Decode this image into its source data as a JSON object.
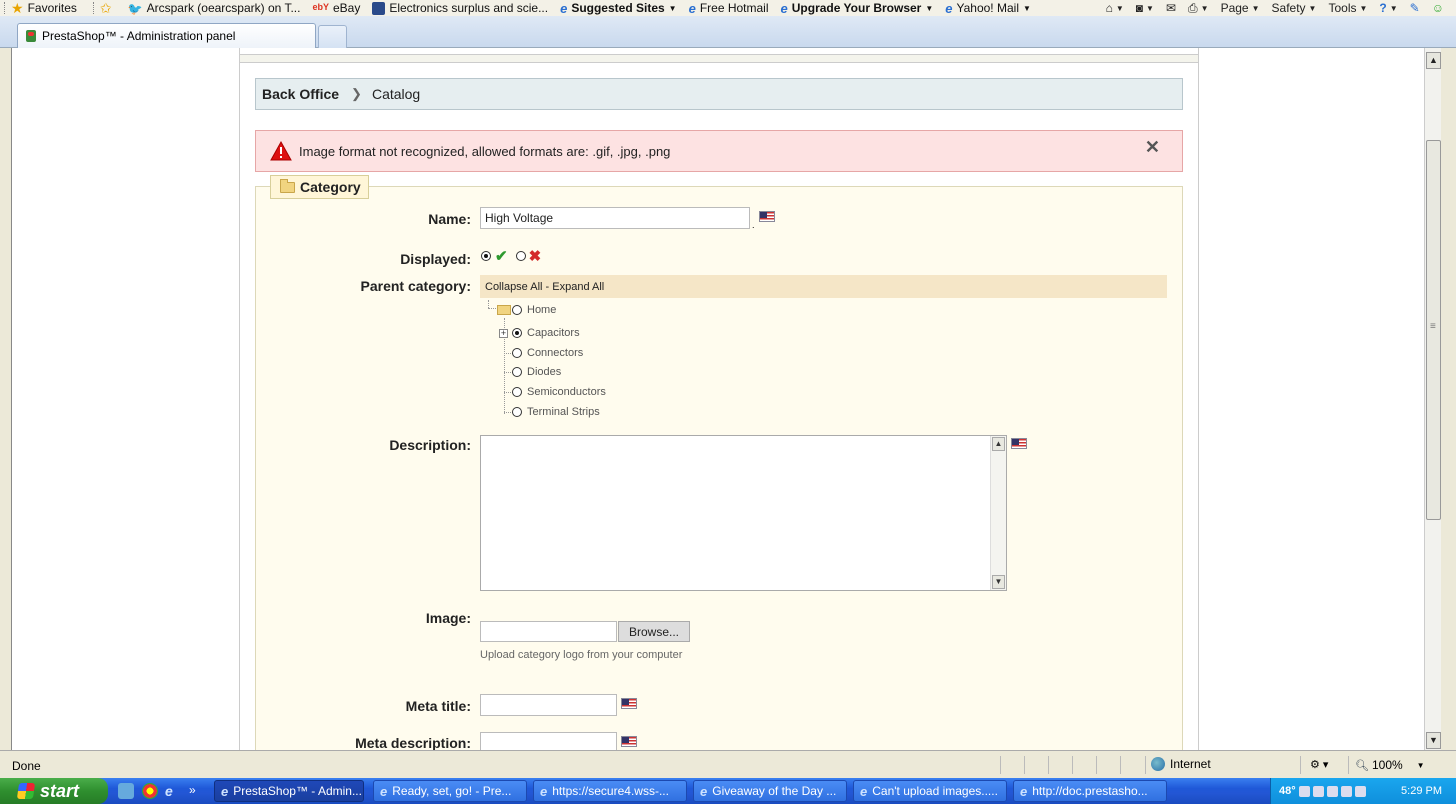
{
  "favorites_bar": {
    "favorites_label": "Favorites",
    "items": [
      {
        "label": "Arcspark (oearcspark) on T...",
        "icon": "twitter-bird-icon"
      },
      {
        "label": "eBay",
        "icon": "ebay-icon"
      },
      {
        "label": "Electronics surplus and scie...",
        "icon": "site-icon"
      },
      {
        "label": "Suggested Sites",
        "icon": "ie-icon",
        "bold": true
      },
      {
        "label": "Free Hotmail",
        "icon": "ie-icon"
      },
      {
        "label": "Upgrade Your Browser",
        "icon": "ie-icon",
        "bold": true
      },
      {
        "label": "Yahoo! Mail",
        "icon": "ie-icon"
      }
    ],
    "toolbar": [
      "Page",
      "Safety",
      "Tools"
    ]
  },
  "tab": {
    "title": "PrestaShop™ - Administration panel"
  },
  "breadcrumb": {
    "root": "Back Office",
    "current": "Catalog"
  },
  "error": {
    "message": "Image format not recognized, allowed formats are: .gif, .jpg, .png"
  },
  "form": {
    "legend": "Category",
    "name_label": "Name:",
    "name_value": "High Voltage",
    "displayed_label": "Displayed:",
    "parent_label": "Parent category:",
    "collapse_all": "Collapse All",
    "tree_sep": " - ",
    "expand_all": "Expand All",
    "tree": {
      "root": "Home",
      "children": [
        "Capacitors",
        "Connectors",
        "Diodes",
        "Semiconductors",
        "Terminal Strips"
      ]
    },
    "description_label": "Description:",
    "image_label": "Image:",
    "browse_label": "Browse...",
    "image_hint": "Upload category logo from your computer",
    "meta_title_label": "Meta title:",
    "meta_description_label": "Meta description:"
  },
  "statusbar": {
    "status": "Done",
    "zone": "Internet",
    "zoom": "100%"
  },
  "taskbar": {
    "start_label": "start",
    "tasks": [
      {
        "label": "PrestaShop™ - Admin...",
        "active": true
      },
      {
        "label": "Ready, set, go! - Pre..."
      },
      {
        "label": "https://secure4.wss-..."
      },
      {
        "label": "Giveaway of the Day ..."
      },
      {
        "label": "Can't upload images....."
      },
      {
        "label": "http://doc.prestasho..."
      }
    ],
    "clock": "5:29 PM",
    "temp": "48°"
  },
  "colors": {
    "error_bg": "#fde2e2",
    "fieldset_bg": "#fffcee",
    "breadcrumb_bg": "#e6eef0",
    "tree_header_bg": "#f5e6c7"
  }
}
